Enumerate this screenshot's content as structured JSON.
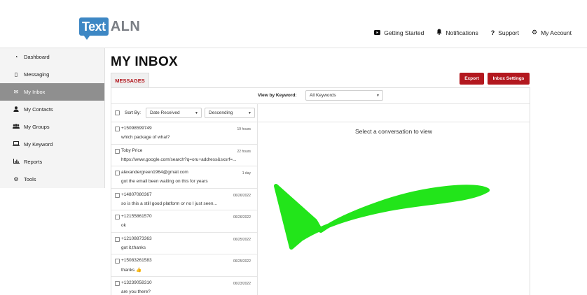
{
  "logo": {
    "mark": "Text",
    "rest": "ALN"
  },
  "topnav": {
    "items": [
      {
        "icon": "video-icon",
        "label": "Getting Started"
      },
      {
        "icon": "bell-icon",
        "label": "Notifications"
      },
      {
        "icon": "question-icon",
        "label": "Support"
      },
      {
        "icon": "gear-icon",
        "label": "My Account"
      }
    ]
  },
  "sidebar": {
    "items": [
      {
        "icon": "dashboard-icon",
        "label": "Dashboard"
      },
      {
        "icon": "phone-icon",
        "label": "Messaging"
      },
      {
        "icon": "envelope-icon",
        "label": "My Inbox"
      },
      {
        "icon": "user-icon",
        "label": "My Contacts"
      },
      {
        "icon": "users-icon",
        "label": "My Groups"
      },
      {
        "icon": "laptop-icon",
        "label": "My Keyword"
      },
      {
        "icon": "chart-icon",
        "label": "Reports"
      },
      {
        "icon": "tools-icon",
        "label": "Tools"
      }
    ],
    "active": "My Inbox"
  },
  "main": {
    "title": "MY INBOX",
    "tab_label": "MESSAGES",
    "export_label": "Export",
    "settings_label": "Inbox Settings",
    "keyword_label": "View by Keyword:",
    "keyword_value": "All Keywords",
    "sort_label": "Sort By:",
    "sort_value": "Date Received",
    "direction_value": "Descending",
    "placeholder": "Select a conversation to view"
  },
  "messages": [
    {
      "name": "+15098599749",
      "time": "19 hours",
      "preview": "which package of what?"
    },
    {
      "name": "Toby Price",
      "time": "22 hours",
      "preview": "https://www.google.com/search?q=oru+address&sxsrf=..."
    },
    {
      "name": "alexandergreen1964@gmail.com",
      "time": "1 day",
      "preview": "got the email been waiting on this for years"
    },
    {
      "name": "+14807080367",
      "time": "06/26/2022",
      "preview": "so is this a still good platform or no I just seen..."
    },
    {
      "name": "+12155861570",
      "time": "06/26/2022",
      "preview": "ok"
    },
    {
      "name": "+12108873363",
      "time": "06/25/2022",
      "preview": "got it,thanks"
    },
    {
      "name": "+15083261583",
      "time": "06/25/2022",
      "preview": "thanks 👍"
    },
    {
      "name": "+13239058310",
      "time": "06/23/2022",
      "preview": "are you there?"
    }
  ],
  "colors": {
    "accent": "#b3181f",
    "logo_blue": "#3d87c4",
    "arrow": "#22e51a",
    "sidebar_active": "#8f8f8f"
  }
}
